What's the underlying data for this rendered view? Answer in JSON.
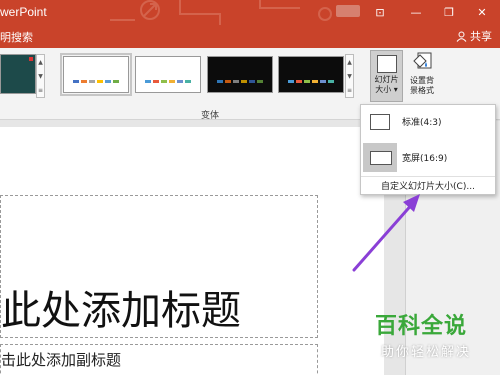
{
  "window": {
    "app_title": "werPoint",
    "controls": {
      "ribbon_display": "⊡",
      "minimize": "—",
      "restore": "❐",
      "close": "✕"
    }
  },
  "tabrow": {
    "tell_me": "明搜索",
    "share_label": "共享"
  },
  "ribbon": {
    "variants": [
      {
        "bg": "#ffffff",
        "bars": [
          "#4472c4",
          "#ed7d31",
          "#a5a5a5",
          "#ffc000",
          "#5b9bd5",
          "#70ad47"
        ]
      },
      {
        "bg": "#ffffff",
        "bars": [
          "#4a9bd8",
          "#e95a3c",
          "#8fbf4a",
          "#f1b033",
          "#6c8fcf",
          "#49b1a4"
        ]
      },
      {
        "bg": "#0c0c0c",
        "bars": [
          "#2e75b6",
          "#c55a11",
          "#7f7f7f",
          "#bf9000",
          "#2f5597",
          "#548235"
        ]
      },
      {
        "bg": "#0c0c0c",
        "bars": [
          "#4a9bd8",
          "#e95a3c",
          "#8fbf4a",
          "#f1b033",
          "#6c8fcf",
          "#49b1a4"
        ]
      }
    ],
    "variants_group_label": "变体",
    "slide_size_label_1": "幻灯片",
    "slide_size_label_2": "大小 ▾",
    "format_bg_label_1": "设置背",
    "format_bg_label_2": "景格式"
  },
  "slide": {
    "title": "此处添加标题",
    "subtitle": "击此处添加副标题"
  },
  "dropdown": {
    "standard_label": "标准(4:3)",
    "widescreen_label": "宽屏(16:9)",
    "custom_label": "自定义幻灯片大小(C)..."
  },
  "watermark": {
    "main": "百科全说",
    "sub": "助你轻松解决"
  },
  "colors": {
    "accent": "#c9432a",
    "arrow": "#8a3fd6",
    "watermark_green": "#3aa83a"
  }
}
